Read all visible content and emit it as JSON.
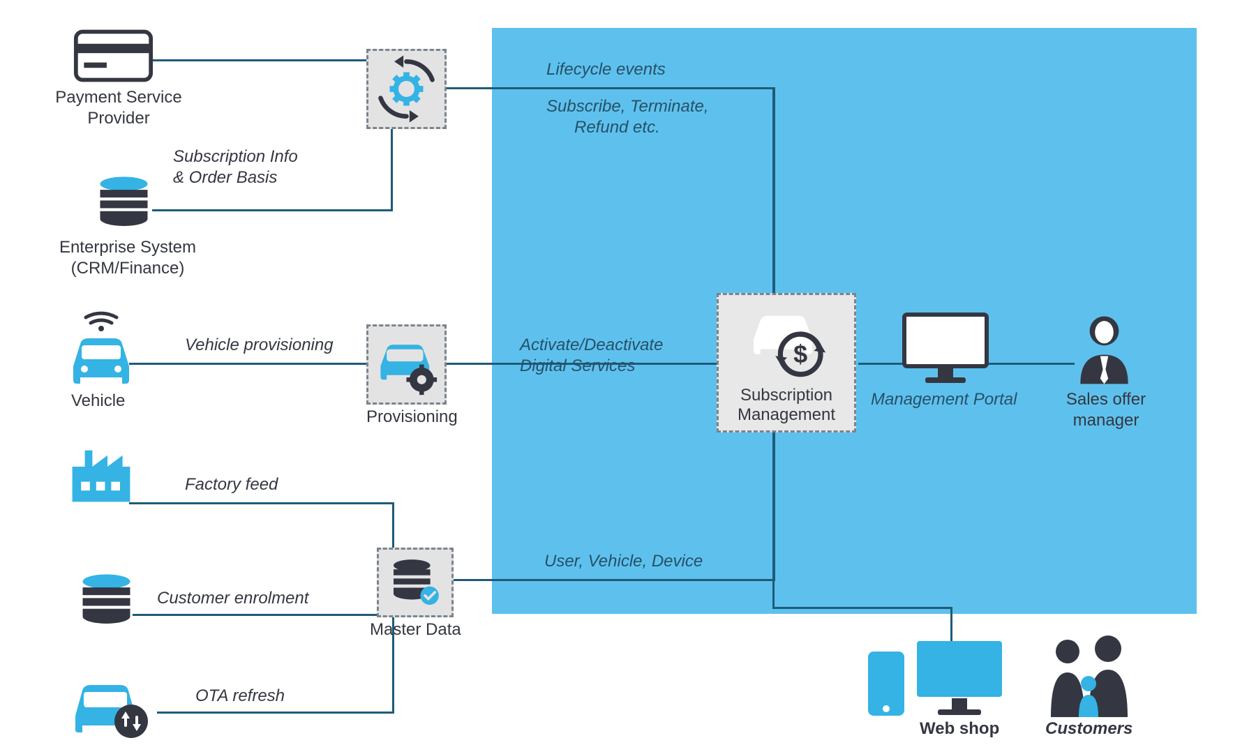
{
  "colors": {
    "region_bg": "#5EC1ED",
    "line": "#1e5b78",
    "dark": "#343741",
    "accent": "#34b3e4",
    "box_bg": "#e3e3e3"
  },
  "nodes": {
    "payment_service_provider": "Payment Service Provider",
    "enterprise_system_l1": "Enterprise System",
    "enterprise_system_l2": "(CRM/Finance)",
    "vehicle": "Vehicle",
    "provisioning": "Provisioning",
    "master_data": "Master Data",
    "subscription_management_l1": "Subscription",
    "subscription_management_l2": "Management",
    "management_portal": "Management Portal",
    "sales_offer_mgr_l1": "Sales offer",
    "sales_offer_mgr_l2": "manager",
    "web_shop": "Web shop",
    "customers": "Customers"
  },
  "edges": {
    "subscription_info_l1": "Subscription Info",
    "subscription_info_l2": "&  Order Basis",
    "lifecycle_events": "Lifecycle events",
    "subscribe_terminate_l1": "Subscribe, Terminate,",
    "subscribe_terminate_l2": "Refund etc.",
    "vehicle_provisioning": "Vehicle provisioning",
    "activate_l1": "Activate/Deactivate",
    "activate_l2": "Digital Services",
    "factory_feed": "Factory feed",
    "customer_enrolment": "Customer enrolment",
    "ota_refresh": "OTA refresh",
    "user_vehicle_device": "User, Vehicle, Device"
  }
}
